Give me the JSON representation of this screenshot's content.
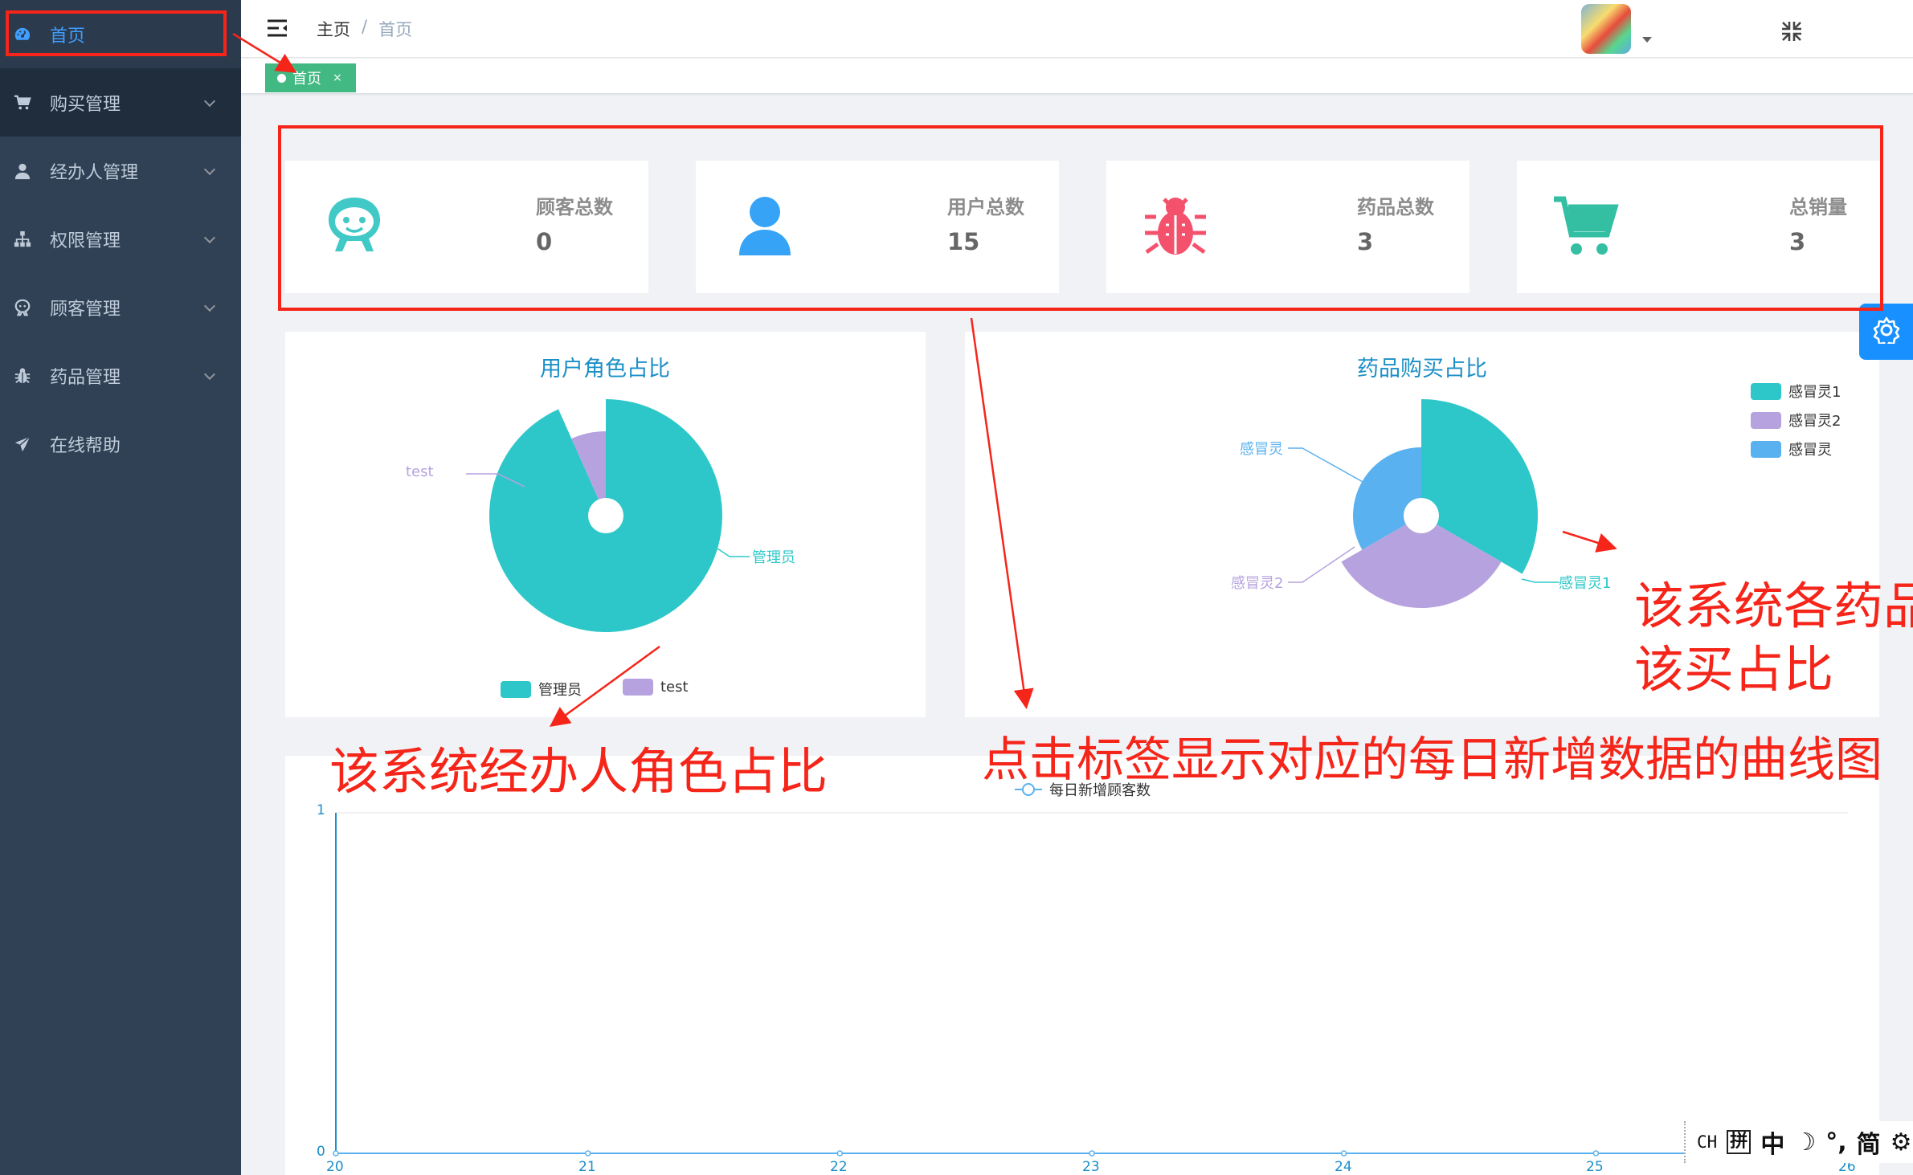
{
  "sidebar": {
    "items": [
      {
        "label": "首页",
        "icon": "dashboard-icon",
        "active": true
      },
      {
        "label": "购买管理",
        "icon": "shopping-cart-icon",
        "has_children": true
      },
      {
        "label": "经办人管理",
        "icon": "user-icon",
        "has_children": true
      },
      {
        "label": "权限管理",
        "icon": "tree-icon",
        "has_children": true
      },
      {
        "label": "顾客管理",
        "icon": "peoples-icon",
        "has_children": true
      },
      {
        "label": "药品管理",
        "icon": "bug-icon",
        "has_children": true
      },
      {
        "label": "在线帮助",
        "icon": "guide-icon",
        "has_children": false
      }
    ]
  },
  "header": {
    "breadcrumb": {
      "home": "主页",
      "separator": "/",
      "current": "首页"
    }
  },
  "tags": [
    {
      "label": "首页",
      "close": "×",
      "active": true
    }
  ],
  "panels": [
    {
      "label": "顾客总数",
      "value": "0",
      "icon": "peoples-icon",
      "color": "#40c9c6"
    },
    {
      "label": "用户总数",
      "value": "15",
      "icon": "user-icon",
      "color": "#36a3f7"
    },
    {
      "label": "药品总数",
      "value": "3",
      "icon": "bug-icon",
      "color": "#f4516c"
    },
    {
      "label": "总销量",
      "value": "3",
      "icon": "shopping-cart-icon",
      "color": "#34bfa3"
    }
  ],
  "chart_data": [
    {
      "type": "pie",
      "title": "用户角色占比",
      "style": "rose",
      "slices": [
        {
          "name": "管理员",
          "value": 14,
          "color": "#2ec7c9"
        },
        {
          "name": "test",
          "value": 1,
          "color": "#b6a2de"
        }
      ],
      "legend": [
        "管理员",
        "test"
      ],
      "legend_position": "bottom"
    },
    {
      "type": "pie",
      "title": "药品购买占比",
      "style": "rose",
      "slices": [
        {
          "name": "感冒灵1",
          "value": 1,
          "color": "#2ec7c9"
        },
        {
          "name": "感冒灵2",
          "value": 1,
          "color": "#b6a2de"
        },
        {
          "name": "感冒灵",
          "value": 1,
          "color": "#5ab1ef"
        }
      ],
      "legend": [
        "感冒灵1",
        "感冒灵2",
        "感冒灵"
      ],
      "legend_position": "top-right"
    },
    {
      "type": "line",
      "series": [
        {
          "name": "每日新增顾客数",
          "values": [
            0,
            0,
            0,
            0,
            0,
            0,
            0
          ],
          "color": "#5ab1ef"
        }
      ],
      "x": [
        "20",
        "21",
        "22",
        "23",
        "24",
        "25",
        "26"
      ],
      "y_ticks": [
        "0",
        "1"
      ],
      "ylim": [
        0,
        1
      ],
      "legend_position": "top"
    }
  ],
  "ime": {
    "ch": "CH",
    "pin": "拼",
    "zhong": "中",
    "jian": "简"
  },
  "annotations": {
    "pie1": "该系统经办人角色占比",
    "pie2_line1": "该系统各药品",
    "pie2_line2": "该买占比",
    "line": "点击标签显示对应的每日新增数据的曲线图"
  },
  "colors": {
    "sidebar_bg": "#304156",
    "active": "#409eff",
    "tag": "#42b983",
    "annotation": "#f5251a"
  }
}
